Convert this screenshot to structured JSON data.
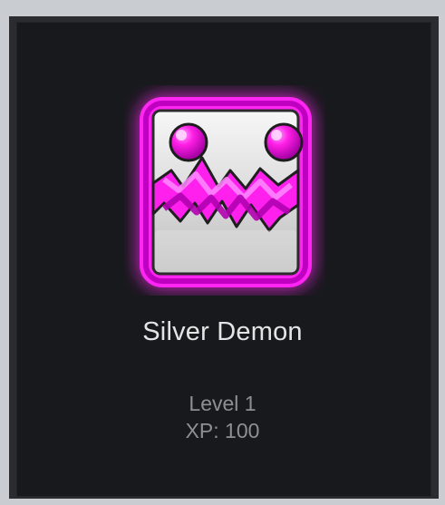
{
  "achievement": {
    "title": "Silver Demon",
    "level_text": "Level 1",
    "xp_text": "XP: 100",
    "icon": "silver-demon-face-icon",
    "glow_color": "#ff1cf0",
    "accent_color": "#c400c4"
  }
}
